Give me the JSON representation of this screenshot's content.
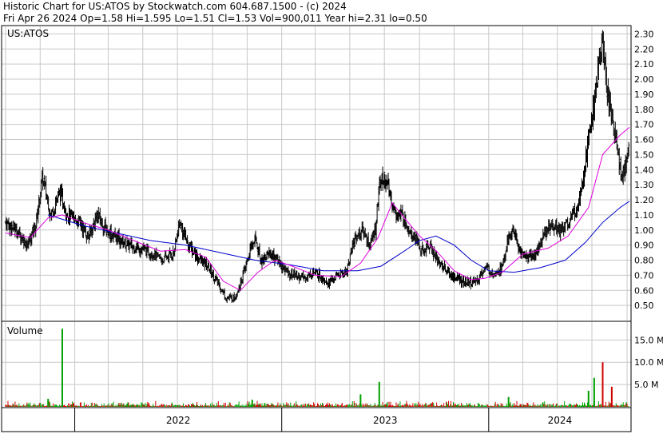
{
  "header": {
    "line1": "Historic Chart for US:ATOS by Stockwatch.com 604.687.1500 - (c) 2024",
    "line2": "Fri Apr 26 2024   Op=1.58  Hi=1.595  Lo=1.51  Cl=1.53  Vol=900,011  Year hi=2.31  lo=0.50"
  },
  "colors": {
    "background": "#ffffff",
    "grid": "#c8c8c8",
    "price_bars": "#000000",
    "ma_short": "#e000e0",
    "ma_long": "#0000cc",
    "volume_up": "#00a000",
    "volume_down": "#d00000"
  },
  "chart_data": [
    {
      "type": "ohlc",
      "symbol_label": "US:ATOS",
      "y_scale": "linear",
      "ylim": [
        0.4,
        2.35
      ],
      "y_ticks": [
        0.5,
        0.6,
        0.7,
        0.8,
        0.9,
        1.0,
        1.1,
        1.2,
        1.3,
        1.4,
        1.5,
        1.6,
        1.7,
        1.8,
        1.9,
        2.0,
        2.1,
        2.2,
        2.3
      ],
      "y_tick_labels": [
        "0.50",
        "0.60",
        "0.70",
        "0.80",
        "0.90",
        "1.00",
        "1.10",
        "1.20",
        "1.30",
        "1.40",
        "1.50",
        "1.60",
        "1.70",
        "1.80",
        "1.90",
        "2.00",
        "2.10",
        "2.20",
        "2.30"
      ],
      "x_tick_labels": [
        "2022",
        "2023",
        "2024"
      ],
      "grid": true,
      "close_path": [
        [
          "2021-09-01",
          1.05
        ],
        [
          "2021-09-20",
          1.0
        ],
        [
          "2021-10-10",
          0.9
        ],
        [
          "2021-10-25",
          1.05
        ],
        [
          "2021-11-05",
          1.35
        ],
        [
          "2021-11-20",
          1.1
        ],
        [
          "2021-12-05",
          1.25
        ],
        [
          "2021-12-20",
          1.1
        ],
        [
          "2022-01-10",
          1.05
        ],
        [
          "2022-01-25",
          0.95
        ],
        [
          "2022-02-10",
          1.1
        ],
        [
          "2022-02-25",
          1.0
        ],
        [
          "2022-03-15",
          0.95
        ],
        [
          "2022-04-05",
          0.9
        ],
        [
          "2022-04-25",
          0.88
        ],
        [
          "2022-05-15",
          0.85
        ],
        [
          "2022-06-05",
          0.8
        ],
        [
          "2022-06-25",
          0.85
        ],
        [
          "2022-07-05",
          1.05
        ],
        [
          "2022-07-20",
          0.9
        ],
        [
          "2022-08-10",
          0.8
        ],
        [
          "2022-08-25",
          0.75
        ],
        [
          "2022-09-10",
          0.65
        ],
        [
          "2022-09-25",
          0.55
        ],
        [
          "2022-10-10",
          0.55
        ],
        [
          "2022-10-25",
          0.7
        ],
        [
          "2022-11-05",
          0.85
        ],
        [
          "2022-11-15",
          0.95
        ],
        [
          "2022-11-25",
          0.8
        ],
        [
          "2022-12-10",
          0.85
        ],
        [
          "2022-12-25",
          0.8
        ],
        [
          "2023-01-10",
          0.72
        ],
        [
          "2023-01-25",
          0.7
        ],
        [
          "2023-02-10",
          0.68
        ],
        [
          "2023-02-25",
          0.72
        ],
        [
          "2023-03-10",
          0.7
        ],
        [
          "2023-03-25",
          0.65
        ],
        [
          "2023-04-10",
          0.7
        ],
        [
          "2023-04-25",
          0.72
        ],
        [
          "2023-05-10",
          0.95
        ],
        [
          "2023-05-25",
          1.0
        ],
        [
          "2023-06-05",
          0.9
        ],
        [
          "2023-06-15",
          1.0
        ],
        [
          "2023-06-22",
          1.3
        ],
        [
          "2023-07-01",
          1.35
        ],
        [
          "2023-07-10",
          1.25
        ],
        [
          "2023-07-20",
          1.1
        ],
        [
          "2023-08-01",
          1.1
        ],
        [
          "2023-08-15",
          1.0
        ],
        [
          "2023-08-25",
          0.95
        ],
        [
          "2023-09-05",
          0.85
        ],
        [
          "2023-09-20",
          0.9
        ],
        [
          "2023-10-05",
          0.78
        ],
        [
          "2023-10-15",
          0.75
        ],
        [
          "2023-10-25",
          0.7
        ],
        [
          "2023-11-05",
          0.68
        ],
        [
          "2023-11-20",
          0.65
        ],
        [
          "2023-12-05",
          0.65
        ],
        [
          "2023-12-15",
          0.68
        ],
        [
          "2023-12-25",
          0.75
        ],
        [
          "2024-01-10",
          0.72
        ],
        [
          "2024-01-25",
          0.75
        ],
        [
          "2024-02-05",
          0.95
        ],
        [
          "2024-02-15",
          1.0
        ],
        [
          "2024-02-25",
          0.85
        ],
        [
          "2024-03-10",
          0.82
        ],
        [
          "2024-03-25",
          0.85
        ],
        [
          "2024-04-05",
          0.95
        ],
        [
          "2024-04-20",
          1.05
        ],
        [
          "2024-05-05",
          1.0
        ],
        [
          "2024-05-20",
          1.05
        ],
        [
          "2024-06-05",
          1.15
        ],
        [
          "2024-06-15",
          1.35
        ],
        [
          "2024-06-25",
          1.6
        ],
        [
          "2024-07-05",
          1.85
        ],
        [
          "2024-07-12",
          2.05
        ],
        [
          "2024-07-20",
          2.25
        ],
        [
          "2024-07-28",
          1.9
        ],
        [
          "2024-08-05",
          1.75
        ],
        [
          "2024-08-15",
          1.55
        ],
        [
          "2024-08-22",
          1.35
        ],
        [
          "2024-08-30",
          1.45
        ],
        [
          "2024-09-05",
          1.53
        ]
      ],
      "ma_short_path": [
        [
          "2021-09-01",
          0.98
        ],
        [
          "2021-10-15",
          0.95
        ],
        [
          "2021-11-15",
          1.08
        ],
        [
          "2021-12-10",
          1.1
        ],
        [
          "2022-01-15",
          1.05
        ],
        [
          "2022-03-01",
          1.0
        ],
        [
          "2022-04-15",
          0.93
        ],
        [
          "2022-06-01",
          0.86
        ],
        [
          "2022-07-15",
          0.87
        ],
        [
          "2022-08-20",
          0.82
        ],
        [
          "2022-09-20",
          0.66
        ],
        [
          "2022-10-20",
          0.6
        ],
        [
          "2022-11-20",
          0.72
        ],
        [
          "2022-12-20",
          0.8
        ],
        [
          "2023-01-20",
          0.76
        ],
        [
          "2023-03-01",
          0.7
        ],
        [
          "2023-04-15",
          0.69
        ],
        [
          "2023-05-20",
          0.78
        ],
        [
          "2023-06-20",
          0.95
        ],
        [
          "2023-07-15",
          1.18
        ],
        [
          "2023-08-01",
          1.1
        ],
        [
          "2023-09-01",
          0.96
        ],
        [
          "2023-10-01",
          0.86
        ],
        [
          "2023-11-01",
          0.73
        ],
        [
          "2023-12-01",
          0.67
        ],
        [
          "2023-12-25",
          0.68
        ],
        [
          "2024-01-25",
          0.72
        ],
        [
          "2024-03-01",
          0.84
        ],
        [
          "2024-04-15",
          0.88
        ],
        [
          "2024-05-20",
          0.96
        ],
        [
          "2024-06-25",
          1.15
        ],
        [
          "2024-07-20",
          1.5
        ],
        [
          "2024-08-20",
          1.63
        ],
        [
          "2024-09-05",
          1.68
        ]
      ],
      "ma_long_path": [
        [
          "2021-11-15",
          1.1
        ],
        [
          "2022-01-15",
          1.03
        ],
        [
          "2022-03-15",
          0.98
        ],
        [
          "2022-05-15",
          0.93
        ],
        [
          "2022-07-15",
          0.9
        ],
        [
          "2022-09-15",
          0.85
        ],
        [
          "2022-11-15",
          0.8
        ],
        [
          "2023-01-15",
          0.77
        ],
        [
          "2023-03-15",
          0.73
        ],
        [
          "2023-05-15",
          0.73
        ],
        [
          "2023-06-25",
          0.76
        ],
        [
          "2023-08-01",
          0.85
        ],
        [
          "2023-09-01",
          0.93
        ],
        [
          "2023-09-30",
          0.96
        ],
        [
          "2023-11-01",
          0.9
        ],
        [
          "2023-12-01",
          0.8
        ],
        [
          "2024-01-01",
          0.73
        ],
        [
          "2024-02-15",
          0.72
        ],
        [
          "2024-04-01",
          0.75
        ],
        [
          "2024-05-15",
          0.8
        ],
        [
          "2024-06-20",
          0.92
        ],
        [
          "2024-07-20",
          1.05
        ],
        [
          "2024-08-20",
          1.15
        ],
        [
          "2024-09-05",
          1.19
        ]
      ]
    },
    {
      "type": "bar",
      "title": "Volume",
      "ylim": [
        0,
        19000000
      ],
      "y_ticks": [
        5000000,
        10000000,
        15000000
      ],
      "y_tick_labels": [
        "5.0 M",
        "10.0 M",
        "15.0 M"
      ],
      "spikes": [
        {
          "date": "2021-11-15",
          "value": 1800000,
          "dir": "up"
        },
        {
          "date": "2021-12-10",
          "value": 17500000,
          "dir": "up"
        },
        {
          "date": "2022-11-10",
          "value": 1600000,
          "dir": "up"
        },
        {
          "date": "2023-05-20",
          "value": 2800000,
          "dir": "up"
        },
        {
          "date": "2023-06-22",
          "value": 5600000,
          "dir": "up"
        },
        {
          "date": "2024-02-05",
          "value": 2200000,
          "dir": "up"
        },
        {
          "date": "2024-06-25",
          "value": 3600000,
          "dir": "up"
        },
        {
          "date": "2024-07-05",
          "value": 6500000,
          "dir": "up"
        },
        {
          "date": "2024-07-20",
          "value": 10000000,
          "dir": "down"
        },
        {
          "date": "2024-08-05",
          "value": 4500000,
          "dir": "down"
        }
      ]
    }
  ]
}
